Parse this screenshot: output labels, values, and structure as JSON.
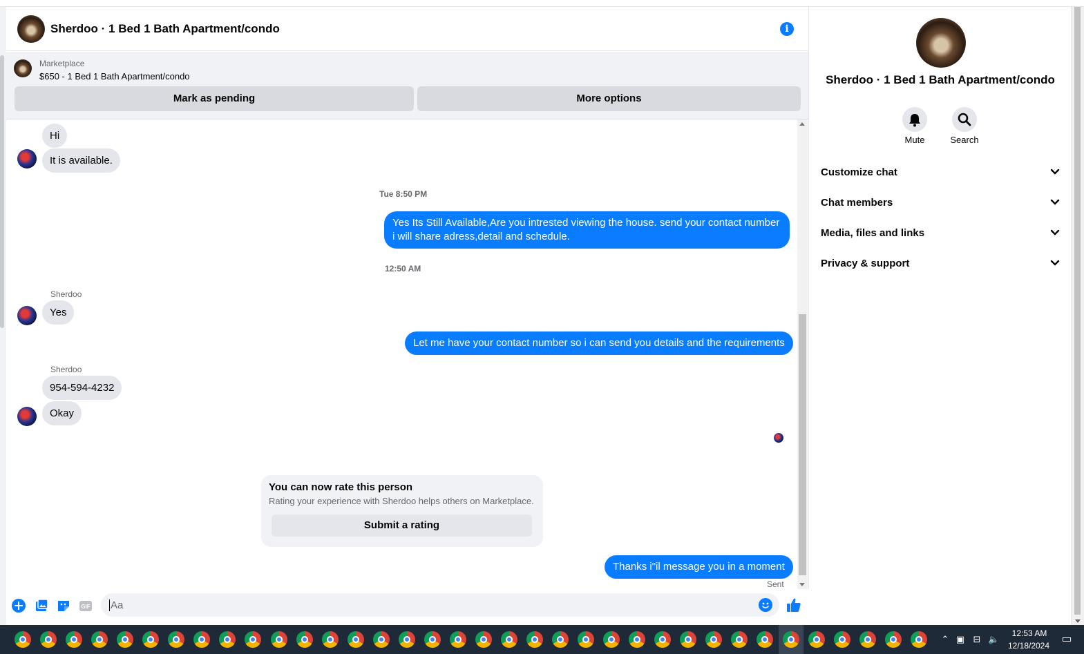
{
  "colors": {
    "accent": "#0a7cff",
    "bubble_in": "#e4e6eb",
    "panel_bg": "#f0f2f5",
    "taskbar": "#1f2a38"
  },
  "header": {
    "title": "Sherdoo · 1 Bed 1 Bath Apartment/condo",
    "info_icon": "info-icon"
  },
  "listing": {
    "label": "Marketplace",
    "price_title": "$650 - 1 Bed 1 Bath Apartment/condo",
    "pending_label": "Mark as pending",
    "more_label": "More options"
  },
  "messages": {
    "in_hi": "Hi",
    "in_available": "It is available.",
    "stamp_1": "Tue 8:50 PM",
    "out_1": "Yes Its Still Available,Are you intrested viewing the house. send your contact number i will share adress,detail and schedule.",
    "stamp_2": "12:50 AM",
    "sender_1": "Sherdoo",
    "in_yes": "Yes",
    "out_2": "Let me have your contact number so i can send you details and the requirements",
    "sender_2": "Sherdoo",
    "in_phone": "954-594-4232",
    "in_okay": "Okay",
    "out_3": "Thanks i\"il message you in a moment",
    "sent_label": "Sent"
  },
  "rating": {
    "title": "You can now rate this person",
    "description": "Rating your experience with Sherdoo helps others on Marketplace.",
    "button": "Submit a rating"
  },
  "composer": {
    "placeholder": "Aa",
    "icons": [
      "plus-icon",
      "image-icon",
      "sticker-icon",
      "gif-icon",
      "emoji-icon",
      "thumbs-up-icon"
    ],
    "gif_text": "GIF"
  },
  "details": {
    "title": "Sherdoo · 1 Bed 1 Bath Apartment/condo",
    "mute_label": "Mute",
    "search_label": "Search",
    "sections": [
      "Customize chat",
      "Chat members",
      "Media, files and links",
      "Privacy & support"
    ]
  },
  "taskbar": {
    "time": "12:53 AM",
    "date": "12/18/2024",
    "app_icon": "chrome-icon",
    "app_count": 36
  }
}
